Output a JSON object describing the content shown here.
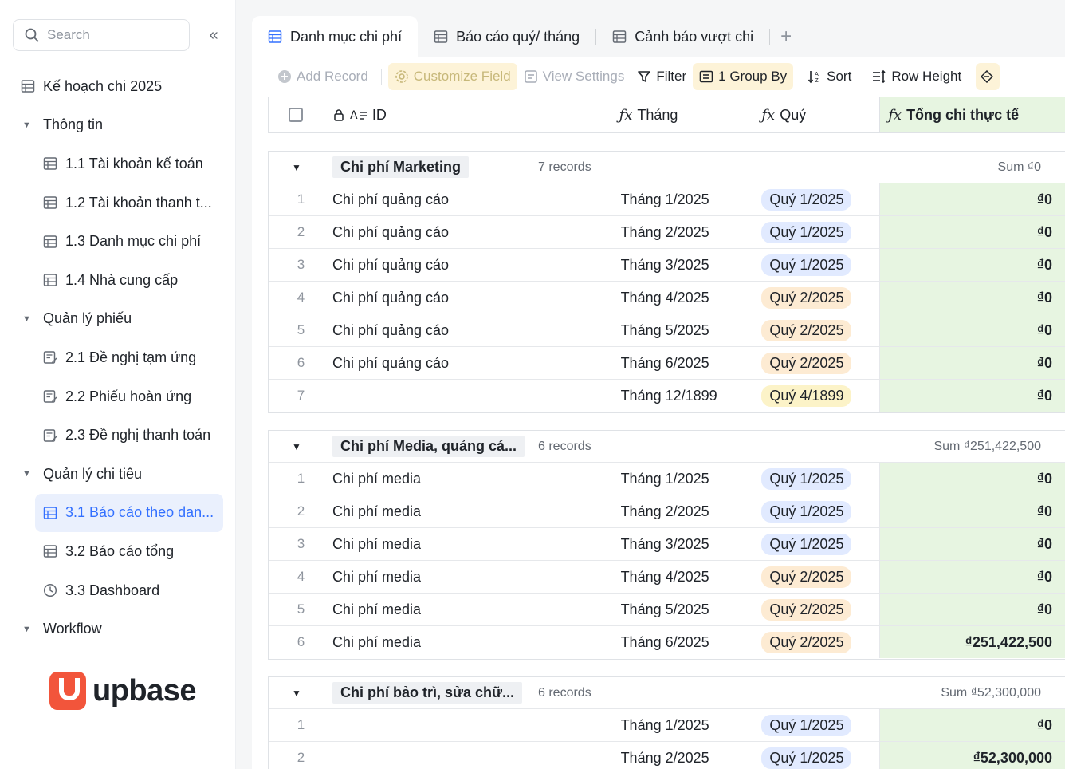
{
  "sidebar": {
    "search_placeholder": "Search",
    "items": [
      {
        "label": "Kế hoạch chi 2025",
        "type": "page",
        "level": 0
      },
      {
        "label": "Thông tin",
        "type": "group"
      },
      {
        "label": "1.1 Tài khoản kế toán",
        "type": "page",
        "level": 1
      },
      {
        "label": "1.2 Tài khoản thanh t...",
        "type": "page",
        "level": 1
      },
      {
        "label": "1.3 Danh mục chi phí",
        "type": "page",
        "level": 1
      },
      {
        "label": "1.4 Nhà cung cấp",
        "type": "page",
        "level": 1
      },
      {
        "label": "Quản lý phiếu",
        "type": "group"
      },
      {
        "label": "2.1 Đề nghị tạm ứng",
        "type": "form",
        "level": 1
      },
      {
        "label": "2.2 Phiếu hoàn ứng",
        "type": "form",
        "level": 1
      },
      {
        "label": "2.3 Đề nghị thanh toán",
        "type": "form",
        "level": 1
      },
      {
        "label": "Quản lý chi tiêu",
        "type": "group"
      },
      {
        "label": "3.1 Báo cáo theo dan...",
        "type": "page",
        "level": 1,
        "active": true
      },
      {
        "label": "3.2 Báo cáo tổng",
        "type": "page",
        "level": 1
      },
      {
        "label": "3.3 Dashboard",
        "type": "dashboard",
        "level": 1
      },
      {
        "label": "Workflow",
        "type": "group"
      }
    ],
    "logo_text": "upbase"
  },
  "tabs": [
    {
      "label": "Danh mục chi phí",
      "active": true
    },
    {
      "label": "Báo cáo quý/ tháng",
      "active": false
    },
    {
      "label": "Cảnh báo vượt chi",
      "active": false
    }
  ],
  "toolbar": {
    "add_record": "Add Record",
    "customize_field": "Customize Field",
    "view_settings": "View Settings",
    "filter": "Filter",
    "group_by": "1 Group By",
    "sort": "Sort",
    "row_height": "Row Height"
  },
  "columns": {
    "id": "ID",
    "thang": "Tháng",
    "quy": "Quý",
    "tong": "Tổng chi thực tế"
  },
  "groups": [
    {
      "name": "Chi phí Marketing",
      "count": "7 records",
      "sum": "Sum ₫0",
      "rows": [
        {
          "n": "1",
          "id": "Chi phí quảng cáo",
          "thang": "Tháng 1/2025",
          "quy": "Quý 1/2025",
          "q": "q1",
          "tong": "₫0"
        },
        {
          "n": "2",
          "id": "Chi phí quảng cáo",
          "thang": "Tháng 2/2025",
          "quy": "Quý 1/2025",
          "q": "q1",
          "tong": "₫0"
        },
        {
          "n": "3",
          "id": "Chi phí quảng cáo",
          "thang": "Tháng 3/2025",
          "quy": "Quý 1/2025",
          "q": "q1",
          "tong": "₫0"
        },
        {
          "n": "4",
          "id": "Chi phí quảng cáo",
          "thang": "Tháng 4/2025",
          "quy": "Quý 2/2025",
          "q": "q2",
          "tong": "₫0"
        },
        {
          "n": "5",
          "id": "Chi phí quảng cáo",
          "thang": "Tháng 5/2025",
          "quy": "Quý 2/2025",
          "q": "q2",
          "tong": "₫0"
        },
        {
          "n": "6",
          "id": "Chi phí quảng cáo",
          "thang": "Tháng 6/2025",
          "quy": "Quý 2/2025",
          "q": "q2",
          "tong": "₫0"
        },
        {
          "n": "7",
          "id": "",
          "thang": "Tháng 12/1899",
          "quy": "Quý 4/1899",
          "q": "q4",
          "tong": "₫0"
        }
      ]
    },
    {
      "name": "Chi phí Media, quảng cá...",
      "count": "6 records",
      "sum": "Sum ₫251,422,500",
      "rows": [
        {
          "n": "1",
          "id": "Chi phí media",
          "thang": "Tháng 1/2025",
          "quy": "Quý 1/2025",
          "q": "q1",
          "tong": "₫0"
        },
        {
          "n": "2",
          "id": "Chi phí media",
          "thang": "Tháng 2/2025",
          "quy": "Quý 1/2025",
          "q": "q1",
          "tong": "₫0"
        },
        {
          "n": "3",
          "id": "Chi phí media",
          "thang": "Tháng 3/2025",
          "quy": "Quý 1/2025",
          "q": "q1",
          "tong": "₫0"
        },
        {
          "n": "4",
          "id": "Chi phí media",
          "thang": "Tháng 4/2025",
          "quy": "Quý 2/2025",
          "q": "q2",
          "tong": "₫0"
        },
        {
          "n": "5",
          "id": "Chi phí media",
          "thang": "Tháng 5/2025",
          "quy": "Quý 2/2025",
          "q": "q2",
          "tong": "₫0"
        },
        {
          "n": "6",
          "id": "Chi phí media",
          "thang": "Tháng 6/2025",
          "quy": "Quý 2/2025",
          "q": "q2",
          "tong": "₫251,422,500"
        }
      ]
    },
    {
      "name": "Chi phí bảo trì, sửa chữ...",
      "count": "6 records",
      "sum": "Sum ₫52,300,000",
      "rows": [
        {
          "n": "1",
          "id": "",
          "thang": "Tháng 1/2025",
          "quy": "Quý 1/2025",
          "q": "q1",
          "tong": "₫0"
        },
        {
          "n": "2",
          "id": "",
          "thang": "Tháng 2/2025",
          "quy": "Quý 1/2025",
          "q": "q1",
          "tong": "₫52,300,000"
        }
      ]
    }
  ]
}
